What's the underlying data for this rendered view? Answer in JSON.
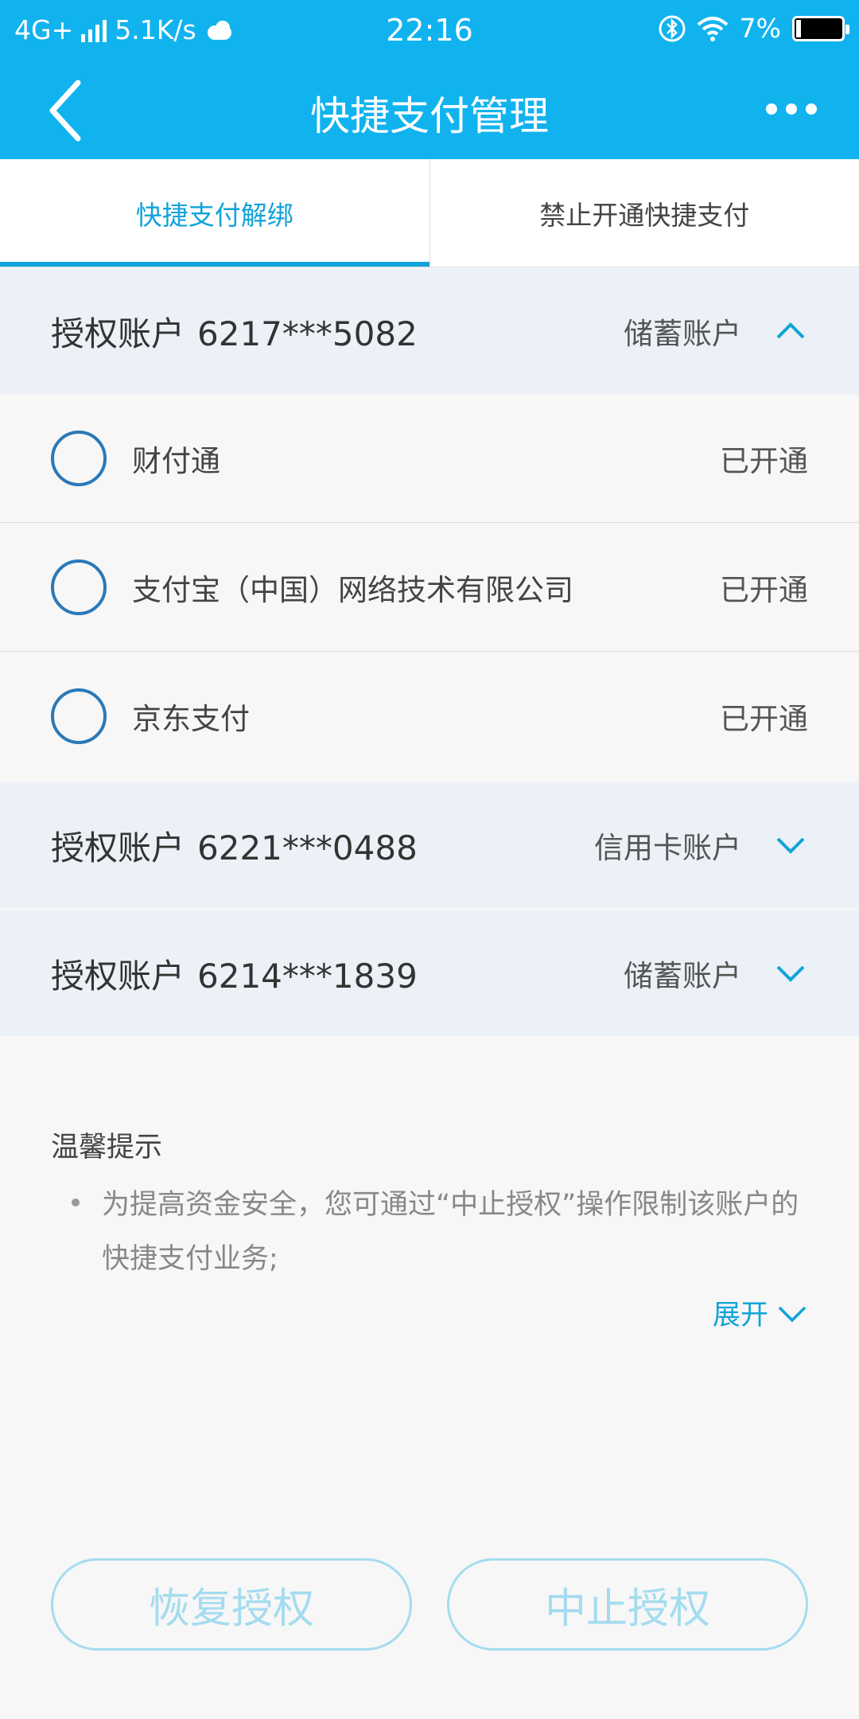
{
  "status_bar": {
    "network": "4G+",
    "speed": "5.1K/s",
    "time": "22:16",
    "battery": "7%"
  },
  "header": {
    "title": "快捷支付管理"
  },
  "tabs": [
    {
      "label": "快捷支付解绑",
      "active": true
    },
    {
      "label": "禁止开通快捷支付",
      "active": false
    }
  ],
  "accounts": [
    {
      "label": "授权账户",
      "number": "6217***5082",
      "type": "储蓄账户",
      "expanded": true,
      "items": [
        {
          "name": "财付通",
          "status": "已开通"
        },
        {
          "name": "支付宝（中国）网络技术有限公司",
          "status": "已开通"
        },
        {
          "name": "京东支付",
          "status": "已开通"
        }
      ]
    },
    {
      "label": "授权账户",
      "number": "6221***0488",
      "type": "信用卡账户",
      "expanded": false
    },
    {
      "label": "授权账户",
      "number": "6214***1839",
      "type": "储蓄账户",
      "expanded": false
    }
  ],
  "tips": {
    "title": "温馨提示",
    "text": "为提高资金安全，您可通过“中止授权”操作限制该账户的快捷支付业务;",
    "expand": "展开"
  },
  "buttons": {
    "restore": "恢复授权",
    "suspend": "中止授权"
  },
  "colors": {
    "brand": "#11b3ef",
    "accent": "#11a3d8",
    "disabled_button": "#a4dcef"
  }
}
